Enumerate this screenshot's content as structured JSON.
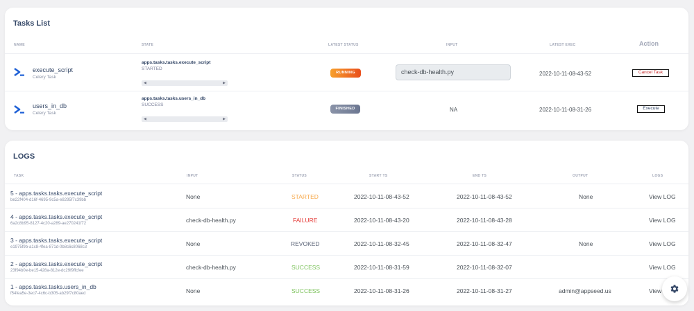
{
  "tasks_card": {
    "title": "Tasks List",
    "headers": {
      "name": "NAME",
      "state": "STATE",
      "latest_status": "LATEST STATUS",
      "input": "INPUT",
      "latest_exec": "LATEST EXEC",
      "action": "Action"
    },
    "rows": [
      {
        "name": "execute_script",
        "type": "Celery Task",
        "state_title": "apps.tasks.tasks.execute_script",
        "state": "STARTED",
        "status": "RUNNING",
        "input": "check-db-health.py",
        "latest_exec": "2022-10-11-08-43-52",
        "action": "Cancel Task"
      },
      {
        "name": "users_in_db",
        "type": "Celery Task",
        "state_title": "apps.tasks.tasks.users_in_db",
        "state": "SUCCESS",
        "status": "FINISHED",
        "input": "NA",
        "latest_exec": "2022-10-11-08-31-26",
        "action": "Execute"
      }
    ],
    "scroll_left": "◀",
    "scroll_right": "▶"
  },
  "logs_card": {
    "title": "LOGS",
    "headers": {
      "task": "TASK",
      "input": "INPUT",
      "status": "STATUS",
      "start_ts": "START TS",
      "end_ts": "END TS",
      "output": "OUTPUT",
      "logs": "LOGS"
    },
    "rows": [
      {
        "task": "5 - apps.tasks.tasks.execute_script",
        "id": "be22f404-d16f-4695-9c5a-e8295f7c39bb",
        "input": "None",
        "status": "STARTED",
        "start": "2022-10-11-08-43-52",
        "end": "2022-10-11-08-43-52",
        "output": "None",
        "log": "View LOG"
      },
      {
        "task": "4 - apps.tasks.tasks.execute_script",
        "id": "6a2c8b95-8127-4c20-a289-ae270241f72",
        "input": "check-db-health.py",
        "status": "FAILURE",
        "start": "2022-10-11-08-43-20",
        "end": "2022-10-11-08-43-28",
        "output": "",
        "log": "View LOG"
      },
      {
        "task": "3 - apps.tasks.tasks.execute_script",
        "id": "e1975f9b-a1c8-4fea-871d-0b8c6c8068c3",
        "input": "None",
        "status": "REVOKED",
        "start": "2022-10-11-08-32-45",
        "end": "2022-10-11-08-32-47",
        "output": "None",
        "log": "View LOG"
      },
      {
        "task": "2 - apps.tasks.tasks.execute_script",
        "id": "23f94b0e-be15-428a-812e-dc29f9ffcfee",
        "input": "check-db-health.py",
        "status": "SUCCESS",
        "start": "2022-10-11-08-31-59",
        "end": "2022-10-11-08-32-07",
        "output": "",
        "log": "View LOG"
      },
      {
        "task": "1 - apps.tasks.tasks.users_in_db",
        "id": "f54fea5e-3ec7-4c6c-b305-ab29f7c80aed",
        "input": "None",
        "status": "SUCCESS",
        "start": "2022-10-11-08-31-26",
        "end": "2022-10-11-08-31-27",
        "output": "admin@appseed.us",
        "log": "View LOG"
      }
    ]
  },
  "colors": {
    "running": "#e94e1b",
    "finished": "#6c7791",
    "failure": "#e53935",
    "started": "#f7a84a",
    "success": "#7cc25b",
    "cancel": "#c62828",
    "task_icon": "#1e60d6"
  },
  "icons": {
    "task_icon": "terminal-prompt-icon",
    "settings": "gear-icon"
  }
}
